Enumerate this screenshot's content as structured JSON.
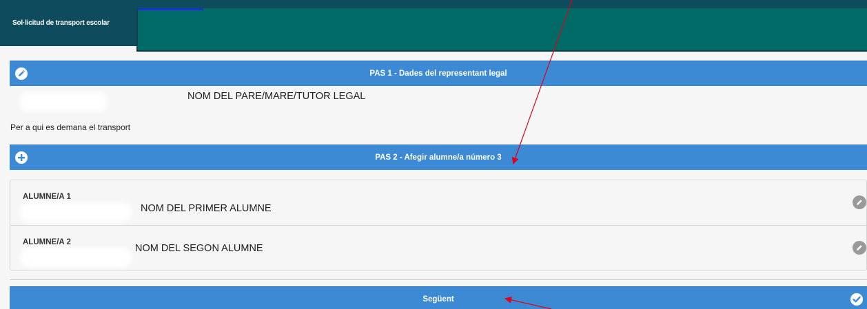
{
  "header": {
    "title": "Sol·licitud de transport escolar"
  },
  "step1": {
    "title": "PAS 1 - Dades del representant legal",
    "icon": "pencil-icon",
    "guardian_name": "NOM DEL PARE/MARE/TUTOR LEGAL"
  },
  "request_for_label": "Per a qui es demana el transport",
  "step2": {
    "title": "PAS 2 - Afegir alumne/a número 3",
    "icon": "plus-icon"
  },
  "students": [
    {
      "label": "ALUMNE/A 1",
      "name": "NOM DEL PRIMER ALUMNE"
    },
    {
      "label": "ALUMNE/A 2",
      "name": "NOM DEL SEGON ALUMNE"
    }
  ],
  "next_button": {
    "label": "Següent",
    "icon": "check-icon"
  },
  "colors": {
    "header_bg": "#0e4b5c",
    "overlay": "#006b66",
    "section_bar": "#3b8ad3",
    "annotation_arrow": "#e0001b"
  }
}
